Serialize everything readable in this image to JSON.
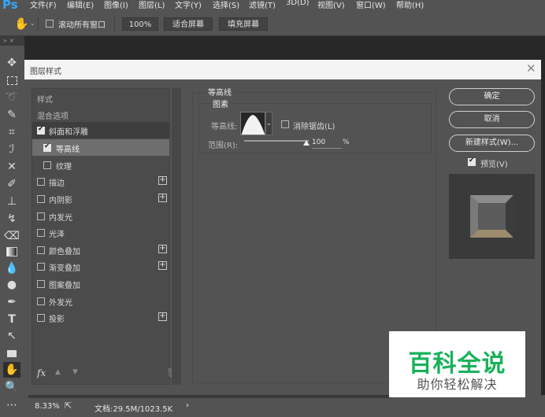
{
  "app": {
    "logo": "Ps"
  },
  "menu": [
    "文件(F)",
    "编辑(E)",
    "图像(I)",
    "图层(L)",
    "文字(Y)",
    "选择(S)",
    "滤镜(T)",
    "3D(D)",
    "视图(V)",
    "窗口(W)",
    "帮助(H)"
  ],
  "options_bar": {
    "scroll_all_windows_label": "滚动所有窗口",
    "scroll_all_windows_checked": false,
    "zoom_value": "100%",
    "fit_screen_label": "适合屏幕",
    "fill_screen_label": "填充屏幕"
  },
  "toolbox": {
    "header": "»  ×",
    "tools": [
      "move-icon",
      "marquee-icon",
      "lasso-icon",
      "quick-select-icon",
      "crop-icon",
      "eyedropper-icon",
      "healing-icon",
      "brush-icon",
      "stamp-icon",
      "history-brush-icon",
      "eraser-icon",
      "gradient-icon",
      "blur-icon",
      "dodge-icon",
      "pen-icon",
      "type-icon",
      "path-select-icon",
      "rectangle-icon",
      "hand-icon",
      "zoom-icon",
      "more-icon"
    ],
    "active_tool": "hand-icon"
  },
  "dialog": {
    "title": "图层样式",
    "styles_header": "样式",
    "blend_options": "混合选项",
    "items": [
      {
        "label": "斜面和浮雕",
        "checked": true,
        "plus": false,
        "state": "selected"
      },
      {
        "label": "等高线",
        "checked": true,
        "plus": false,
        "state": "sub-active"
      },
      {
        "label": "纹理",
        "checked": false,
        "plus": false,
        "state": "sub"
      },
      {
        "label": "描边",
        "checked": false,
        "plus": true,
        "state": ""
      },
      {
        "label": "内阴影",
        "checked": false,
        "plus": true,
        "state": ""
      },
      {
        "label": "内发光",
        "checked": false,
        "plus": false,
        "state": ""
      },
      {
        "label": "光泽",
        "checked": false,
        "plus": false,
        "state": ""
      },
      {
        "label": "颜色叠加",
        "checked": false,
        "plus": true,
        "state": ""
      },
      {
        "label": "渐变叠加",
        "checked": false,
        "plus": true,
        "state": ""
      },
      {
        "label": "图案叠加",
        "checked": false,
        "plus": false,
        "state": ""
      },
      {
        "label": "外发光",
        "checked": false,
        "plus": false,
        "state": ""
      },
      {
        "label": "投影",
        "checked": false,
        "plus": true,
        "state": ""
      }
    ],
    "footer_fx": "fx",
    "contour_section": "等高线",
    "elements_section": "图素",
    "contour_label": "等高线:",
    "antialias_label": "消除锯齿(L)",
    "antialias_checked": false,
    "range_label": "范围(R):",
    "range_value": "100",
    "range_unit": "%",
    "range_fraction": 0.93,
    "ok_label": "确定",
    "cancel_label": "取消",
    "new_style_label": "新建样式(W)...",
    "preview_label": "预览(V)",
    "preview_checked": true
  },
  "status": {
    "zoom": "8.33%",
    "doc": "文档:29.5M/1023.5K",
    "arrow": "›"
  },
  "watermark": {
    "line1": "百科全说",
    "line2": "助你轻松解决"
  },
  "colors": {
    "ps_blue": "#31a8ff",
    "panel": "#535353",
    "watermark_green": "#18b15a"
  }
}
